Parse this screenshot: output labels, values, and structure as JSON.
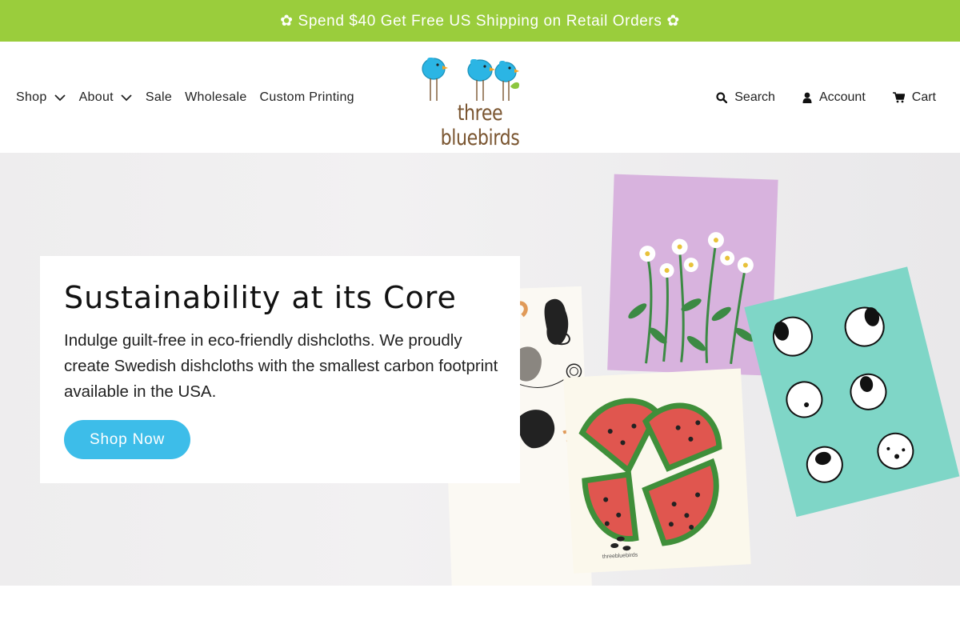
{
  "announcement": "✿ Spend $40 Get Free US Shipping on Retail Orders ✿",
  "nav": {
    "shop": "Shop",
    "about": "About",
    "sale": "Sale",
    "wholesale": "Wholesale",
    "custom_printing": "Custom Printing"
  },
  "logo": {
    "text": "three bluebirds"
  },
  "utility": {
    "search": "Search",
    "account": "Account",
    "cart": "Cart"
  },
  "hero": {
    "title": "Sustainability at its Core",
    "body": "Indulge guilt-free in eco-friendly dishcloths. We proudly create Swedish dishcloths with the smallest carbon footprint available in the USA.",
    "button": "Shop Now",
    "cloth_brand": "threebluebirds"
  },
  "colors": {
    "announcement_bg": "#9acd3c",
    "button_bg": "#3dbde9",
    "bird_blue": "#2bb5e4",
    "logo_brown": "#7a5530"
  }
}
